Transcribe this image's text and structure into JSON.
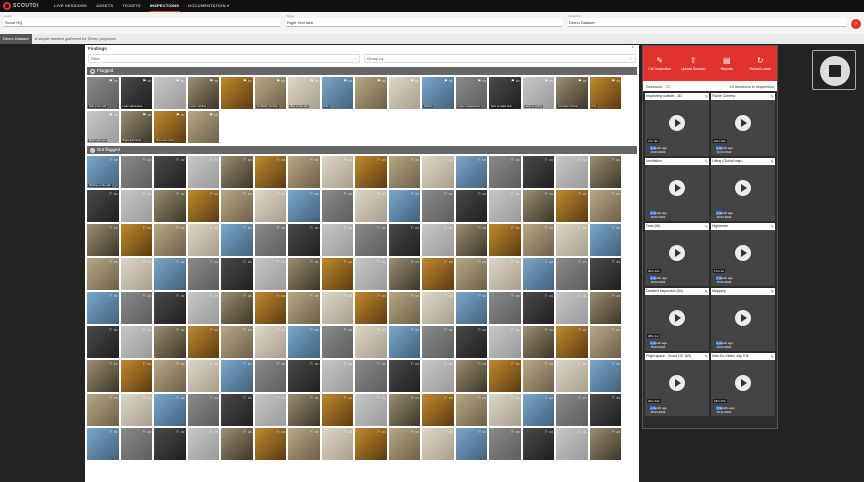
{
  "app": {
    "logo_text": "SCOUTDI",
    "brand_color": "#e0332e"
  },
  "nav": [
    {
      "label": "LIVE SESSIONS",
      "active": false
    },
    {
      "label": "ASSETS",
      "active": false
    },
    {
      "label": "TICKETS",
      "active": false
    },
    {
      "label": "INSPECTIONS",
      "active": true
    },
    {
      "label": "DOCUMENTATION ▾",
      "active": false
    }
  ],
  "filters": [
    {
      "label": "Asset",
      "value": "Scout HQ"
    },
    {
      "label": "Target",
      "value": "Right Test tank"
    },
    {
      "label": "Inspection",
      "value": "Demo Dataset"
    }
  ],
  "tabs": {
    "active": "Demo Dataset",
    "description": "A simple dataset gathered for Demo purposes"
  },
  "findings": {
    "title": "Findings",
    "filter_placeholder": "Filter",
    "group_placeholder": "Group by",
    "flagged_label": "Flagged",
    "not_flagged_label": "Not flagged",
    "flagged_labels": [
      "Hole in the wall",
      "Leak maintenance",
      "",
      "Lower Landing",
      "",
      "Ventilation opening",
      "Pipe on the wall",
      "Pillar",
      "",
      "",
      "Sample",
      "Large in appearance",
      "Rust by water tank",
      "Lamp on ceiling",
      "Corrosion forming",
      "Drip",
      "Bright gold pipe",
      "Bright gold lamps",
      "Pipe near ceiling",
      ""
    ],
    "notflagged_labels": [
      "Pipeline on the wall",
      "",
      "",
      "",
      "",
      "",
      "",
      "",
      "",
      "",
      "",
      "",
      "",
      "",
      "",
      "",
      "",
      ""
    ]
  },
  "sessions": {
    "title": "Sessions",
    "count_badge": "75",
    "summary": "10 sessions in inspection",
    "actions": [
      {
        "label": "Clin Inspection",
        "icon": "✎"
      },
      {
        "label": "Upload Session",
        "icon": "⇪"
      },
      {
        "label": "Reports",
        "icon": "▤"
      },
      {
        "label": "Reload Loads",
        "icon": "↻"
      }
    ],
    "cards": [
      {
        "title": "Inspecting outside - 3D",
        "date": "a month ago",
        "sub": "16.03.2022",
        "dur": "3 hr 4m",
        "img": "t3"
      },
      {
        "title": "Flame Camera",
        "date": "a month ago",
        "sub": "16.03.2022",
        "dur": "10m 44s",
        "img": "t2"
      },
      {
        "title": "Ventilation",
        "date": "a month ago",
        "sub": "16.03.2022",
        "dur": "",
        "img": "t0"
      },
      {
        "title": "Lifting (Global map)",
        "date": "a month ago",
        "sub": "15.03.2022",
        "dur": "",
        "img": "t6"
      },
      {
        "title": "Tank (Mi)",
        "date": "a month ago",
        "sub": "15.03.2022",
        "dur": "3hm 10s",
        "img": "t7"
      },
      {
        "title": "Highbeam",
        "date": "a month ago",
        "sub": "15.03.2022",
        "dur": "17m 3s",
        "img": "t4"
      },
      {
        "title": "Detailed inspection (MI)",
        "date": "a month ago",
        "sub": "15.03.2022",
        "dur": "28m 1m",
        "img": "t5"
      },
      {
        "title": "Mapping",
        "date": "a month ago",
        "sub": "15.03.2022",
        "dur": "",
        "img": "t0"
      },
      {
        "title": "Flight space - Scout 137 (MI)",
        "date": "a month ago",
        "sub": "15.03.2022",
        "dur": "20m 42s",
        "img": "t4"
      },
      {
        "title": "Inda Oo Video: ody 9 lit",
        "date": "3 months ago",
        "sub": "15.12.2021",
        "dur": "18m 37s",
        "img": "t7"
      }
    ]
  }
}
